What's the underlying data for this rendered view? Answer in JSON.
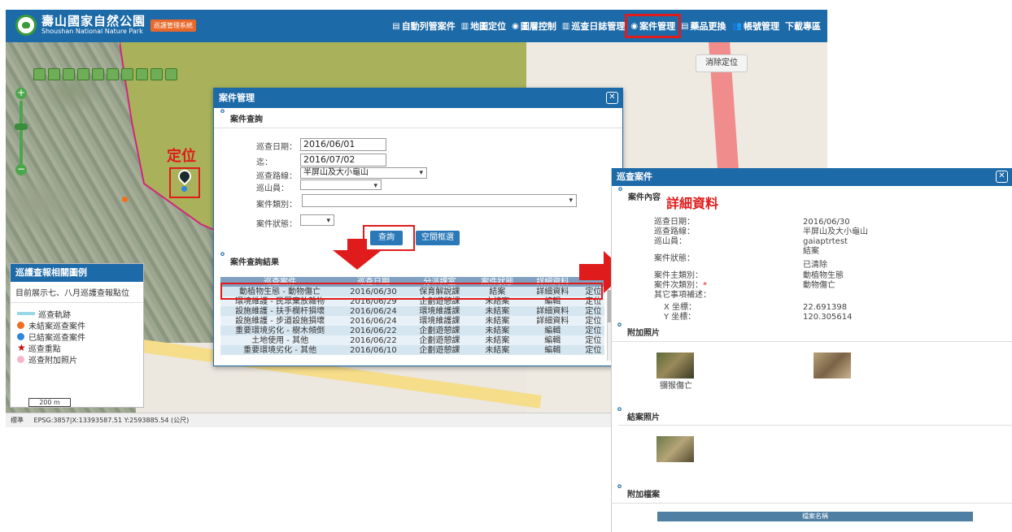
{
  "app": {
    "logo_zh": "壽山國家自然公園",
    "logo_en": "Shoushan National Nature Park",
    "system_badge": "巡護管理系統"
  },
  "topnav": [
    {
      "icon": "document-icon",
      "glyph": "▤",
      "label": "自動列管案件"
    },
    {
      "icon": "chart-icon",
      "glyph": "▥",
      "label": "地圖定位"
    },
    {
      "icon": "layers-icon",
      "glyph": "◉",
      "label": "圖層控制"
    },
    {
      "icon": "chart-icon",
      "glyph": "▥",
      "label": "巡查日誌管理"
    },
    {
      "icon": "gear-icon",
      "glyph": "◉",
      "label": "案件管理",
      "highlighted": true
    },
    {
      "icon": "document-icon",
      "glyph": "▤",
      "label": "藥品更換"
    },
    {
      "icon": "users-icon",
      "glyph": "👥",
      "label": "帳號管理"
    },
    {
      "icon": "download-icon",
      "glyph": "",
      "label": "下載專區"
    }
  ],
  "map": {
    "clear_location": "消除定位",
    "locate_label": "定位",
    "scale": "200 m",
    "status": "EPSG:3857|X:13393587.51 Y:2593885.54 (公尺)",
    "status_prefix": "標準"
  },
  "legend": {
    "title": "巡護查報相關圖例",
    "subtitle": "目前展示七、八月巡護查報點位",
    "items": [
      {
        "symbol": "line",
        "color": "#9ad8e8",
        "label": "巡查軌跡"
      },
      {
        "symbol": "dot",
        "color": "#f07020",
        "label": "未結案巡查案件"
      },
      {
        "symbol": "dot",
        "color": "#2e86de",
        "label": "已結案巡查案件"
      },
      {
        "symbol": "star",
        "color": "#c01010",
        "label": "巡查重點"
      },
      {
        "symbol": "dot",
        "color": "#f7b6c8",
        "label": "巡查附加照片"
      }
    ]
  },
  "case_dialog": {
    "title": "案件管理",
    "query_section": "案件查詢",
    "fields": {
      "date_label": "巡查日期：",
      "date_from": "2016/06/01",
      "to_label": "迄：",
      "date_to": "2016/07/02",
      "route_label": "巡查路線：",
      "route_value": "半屏山及大小龜山",
      "ranger_label": "巡山員：",
      "ranger_value": "",
      "category_label": "案件類別：",
      "category_value": "",
      "status_label": "案件狀態：",
      "status_value": ""
    },
    "query_button": "查詢",
    "spatial_button": "空間框選",
    "results_section": "案件查詢結果",
    "table": {
      "headers": [
        "巡查案件",
        "巡查日期",
        "分派課室",
        "案件狀態",
        "詳細資料",
        ""
      ],
      "rows": [
        [
          "動植物生態 - 動物傷亡",
          "2016/06/30",
          "保育解說課",
          "結案",
          "詳細資料",
          "定位"
        ],
        [
          "環境維護 - 民眾棄放雜物",
          "2016/06/29",
          "企劃遊憩課",
          "未結案",
          "編輯",
          "定位"
        ],
        [
          "設施維護 - 扶手欄杆損壞",
          "2016/06/24",
          "環境維護課",
          "未結案",
          "詳細資料",
          "定位"
        ],
        [
          "設施維護 - 步道設施損壞",
          "2016/06/24",
          "環境維護課",
          "未結案",
          "詳細資料",
          "定位"
        ],
        [
          "重要環境劣化 - 樹木傾倒",
          "2016/06/22",
          "企劃遊憩課",
          "未結案",
          "編輯",
          "定位"
        ],
        [
          "土地使用 - 其他",
          "2016/06/22",
          "企劃遊憩課",
          "未結案",
          "編輯",
          "定位"
        ],
        [
          "重要環境劣化 - 其他",
          "2016/06/10",
          "企劃遊憩課",
          "未結案",
          "編輯",
          "定位"
        ]
      ]
    }
  },
  "detail": {
    "title": "巡查案件",
    "content_section": "案件內容",
    "big_label": "詳細資料",
    "labels": [
      "巡查日期：",
      "巡查路線：",
      "巡山員：",
      "案件狀態：",
      "案件主類別：",
      "案件次類別：",
      "其它事項補述：",
      "X 坐標：",
      "Y 坐標："
    ],
    "values": {
      "date": "2016/06/30",
      "route": "半屏山及大小龜山",
      "ranger": "gaiaptrtest",
      "status1": "結案",
      "status2": "已清除",
      "main_category": "動植物生態",
      "sub_category": "動物傷亡",
      "x": "22.691398",
      "y": "120.305614"
    },
    "required_mark": "*",
    "photos_section": "附加照片",
    "photo_caption": "獼猴傷亡",
    "closing_section": "結案照片",
    "files_section": "附加檔案",
    "file_header": "檔案名稱"
  }
}
